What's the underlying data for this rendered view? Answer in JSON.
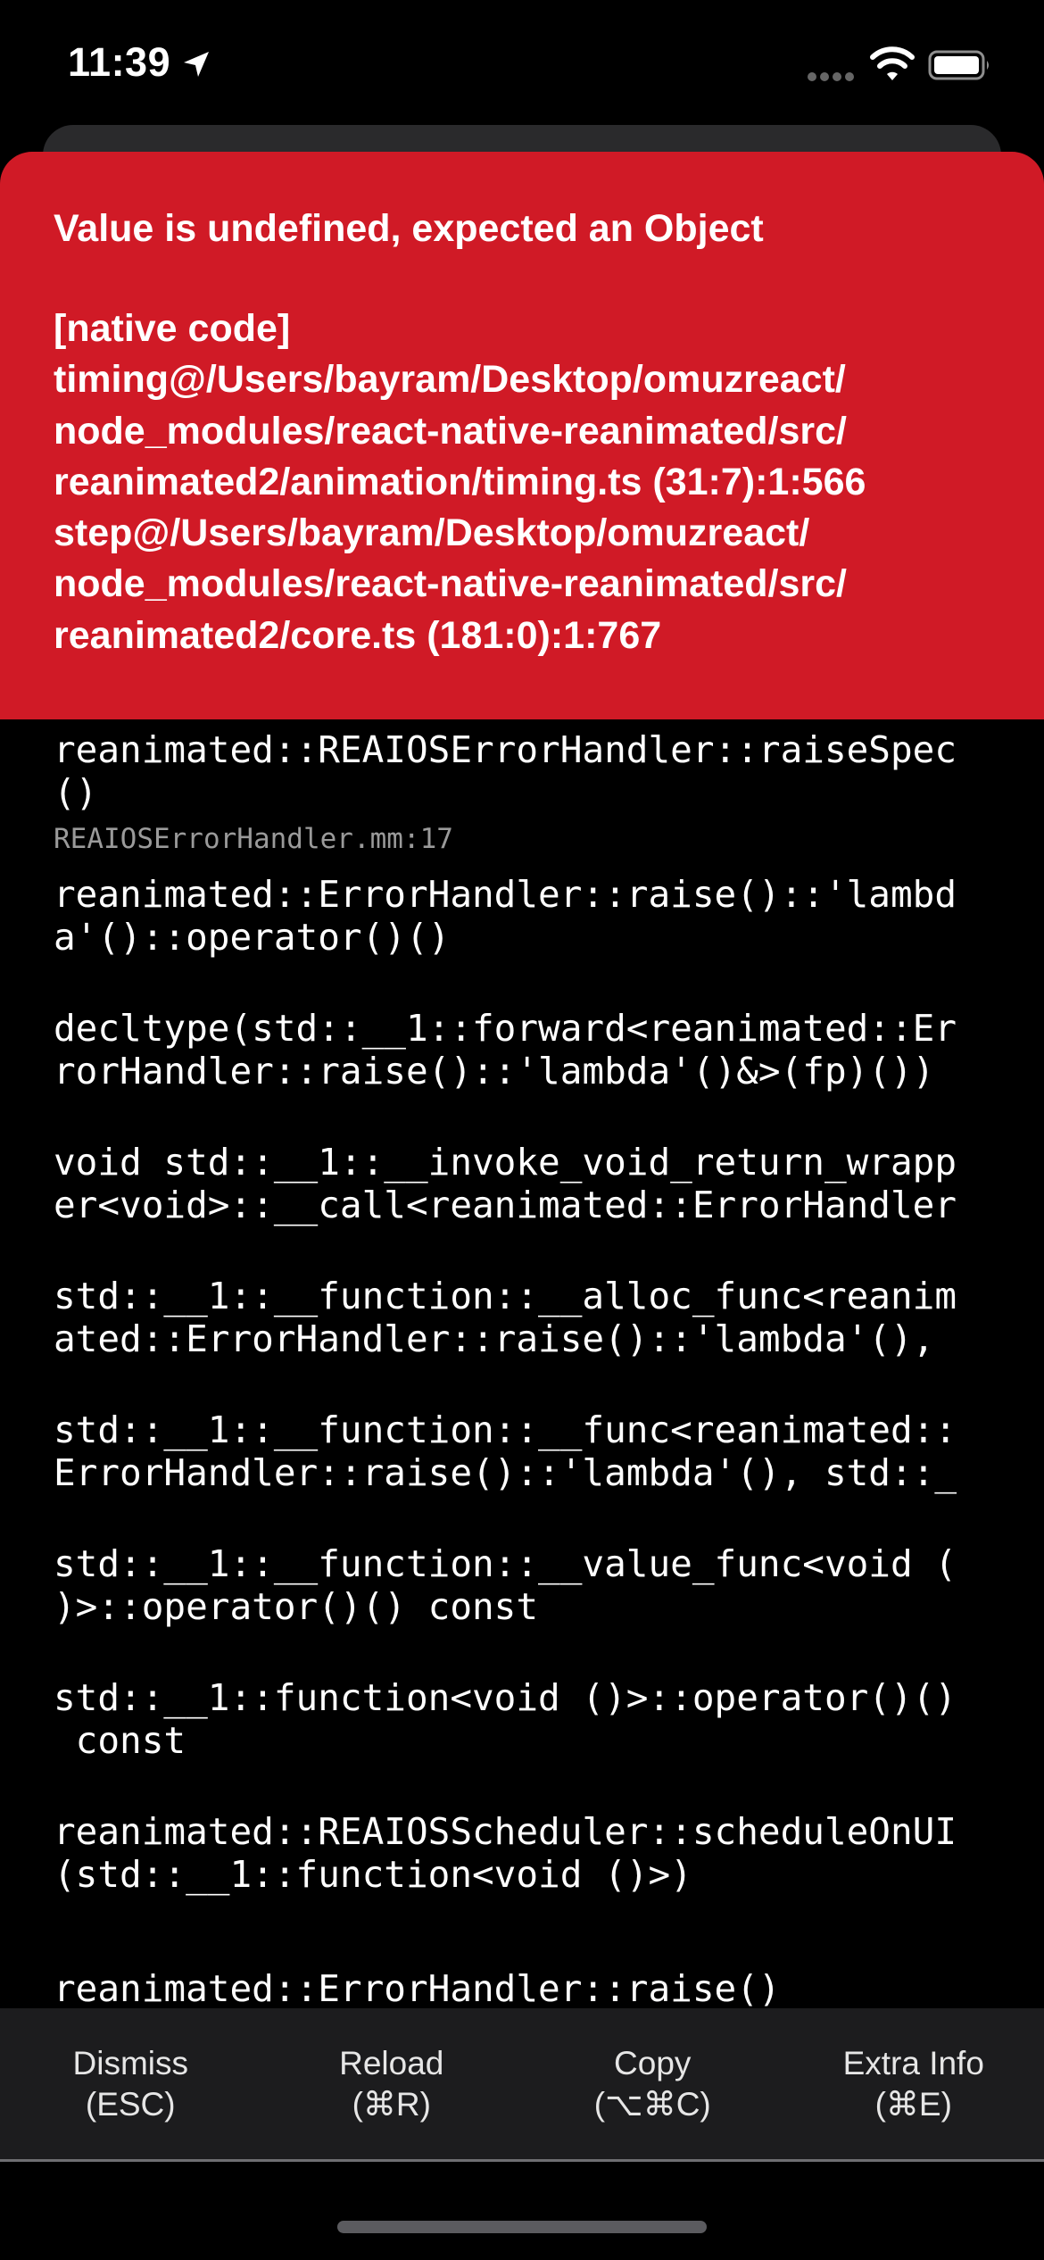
{
  "status_bar": {
    "time": "11:39",
    "icons": [
      "location-arrow-icon",
      "cellular-signal-icon",
      "wifi-icon",
      "battery-icon"
    ]
  },
  "error": {
    "title": "Value is undefined, expected an Object",
    "stack_lines": [
      "[native code]",
      "timing@/Users/bayram/Desktop/omuzreact/",
      "node_modules/react-native-reanimated/src/",
      "reanimated2/animation/timing.ts (31:7):1:566",
      "step@/Users/bayram/Desktop/omuzreact/",
      "node_modules/react-native-reanimated/src/",
      "reanimated2/core.ts (181:0):1:767"
    ]
  },
  "native_stack": [
    {
      "lines": [
        "reanimated::REAIOSErrorHandler::raiseSpec",
        "()"
      ],
      "file": "REAIOSErrorHandler.mm:17"
    },
    {
      "lines": [
        "reanimated::ErrorHandler::raise()::'lambd",
        "a'()::operator()()"
      ],
      "file": ""
    },
    {
      "lines": [
        "decltype(std::__1::forward<reanimated::Er",
        "rorHandler::raise()::'lambda'()&>(fp)())"
      ],
      "file": ""
    },
    {
      "lines": [
        "void std::__1::__invoke_void_return_wrapp",
        "er<void>::__call<reanimated::ErrorHandler"
      ],
      "file": ""
    },
    {
      "lines": [
        "std::__1::__function::__alloc_func<reanim",
        "ated::ErrorHandler::raise()::'lambda'(),"
      ],
      "file": ""
    },
    {
      "lines": [
        "std::__1::__function::__func<reanimated::",
        "ErrorHandler::raise()::'lambda'(), std::_"
      ],
      "file": ""
    },
    {
      "lines": [
        "std::__1::__function::__value_func<void (",
        ")>::operator()() const"
      ],
      "file": ""
    },
    {
      "lines": [
        "std::__1::function<void ()>::operator()()",
        " const"
      ],
      "file": ""
    },
    {
      "lines": [
        "reanimated::REAIOSScheduler::scheduleOnUI",
        "(std::__1::function<void ()>)"
      ],
      "file": ""
    },
    {
      "lines": [
        "reanimated::ErrorHandler::raise()"
      ],
      "file": ""
    }
  ],
  "toolbar": {
    "dismiss": {
      "label": "Dismiss",
      "shortcut": "(ESC)"
    },
    "reload": {
      "label": "Reload",
      "shortcut": "(⌘R)"
    },
    "copy": {
      "label": "Copy",
      "shortcut": "(⌥⌘C)"
    },
    "extra_info": {
      "label": "Extra Info",
      "shortcut": "(⌘E)"
    }
  },
  "colors": {
    "banner": "#d01a26",
    "background": "#000000",
    "toolbar": "#1c1c1e",
    "file_text": "#9a9a9a"
  }
}
